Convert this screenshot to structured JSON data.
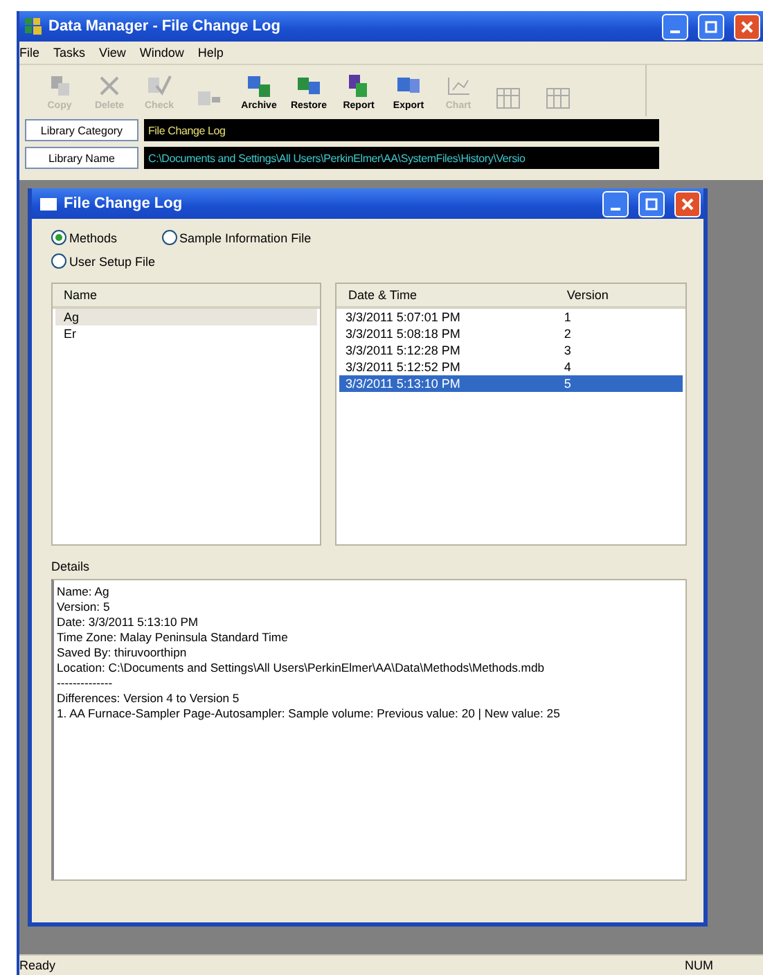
{
  "window": {
    "title": "Data Manager - File Change Log"
  },
  "menu": [
    "File",
    "Tasks",
    "View",
    "Window",
    "Help"
  ],
  "toolbar": [
    {
      "label": "Copy",
      "disabled": true
    },
    {
      "label": "Delete",
      "disabled": true
    },
    {
      "label": "Check",
      "disabled": true
    },
    {
      "disabled": true
    },
    {
      "label": "Archive",
      "disabled": false
    },
    {
      "label": "Restore",
      "disabled": false
    },
    {
      "label": "Report",
      "disabled": false
    },
    {
      "label": "Export",
      "disabled": false
    },
    {
      "label": "Chart",
      "disabled": true
    },
    {
      "disabled": true
    },
    {
      "disabled": true
    }
  ],
  "library": [
    {
      "label": "Library Category",
      "value": "File Change Log"
    },
    {
      "label": "Library Name",
      "value": "C:\\Documents and Settings\\All Users\\PerkinElmer\\AA\\SystemFiles\\History\\Versio"
    }
  ],
  "dialog": {
    "title": "File Change Log",
    "file_types": [
      {
        "label": "Methods",
        "selected": true
      },
      {
        "label": "Sample Information File",
        "selected": false
      },
      {
        "label": "User Setup File",
        "selected": false
      }
    ],
    "names": {
      "column": "Name",
      "rows": [
        {
          "name": "Ag",
          "selected": true
        },
        {
          "name": "Er",
          "selected": false
        }
      ]
    },
    "versions": {
      "columns": [
        "Date & Time",
        "Version"
      ],
      "rows": [
        {
          "date": "3/3/2011 5:07:01 PM",
          "version": "1",
          "selected": false
        },
        {
          "date": "3/3/2011 5:08:18 PM",
          "version": "2",
          "selected": false
        },
        {
          "date": "3/3/2011 5:12:28 PM",
          "version": "3",
          "selected": false
        },
        {
          "date": "3/3/2011 5:12:52 PM",
          "version": "4",
          "selected": false
        },
        {
          "date": "3/3/2011 5:13:10 PM",
          "version": "5",
          "selected": true
        }
      ]
    },
    "details_label": "Details",
    "details": [
      "Name: Ag",
      "Version: 5",
      "Date: 3/3/2011 5:13:10 PM",
      "Time Zone: Malay Peninsula Standard Time",
      "Saved By: thiruvoorthipn",
      "Location: C:\\Documents and Settings\\All Users\\PerkinElmer\\AA\\Data\\Methods\\Methods.mdb",
      "--------------",
      "Differences: Version 4 to Version 5",
      "1. AA Furnace-Sampler Page-Autosampler: Sample volume: Previous value: 20 | New value: 25"
    ]
  },
  "status_bar": {
    "left": "Ready",
    "right": "NUM"
  }
}
